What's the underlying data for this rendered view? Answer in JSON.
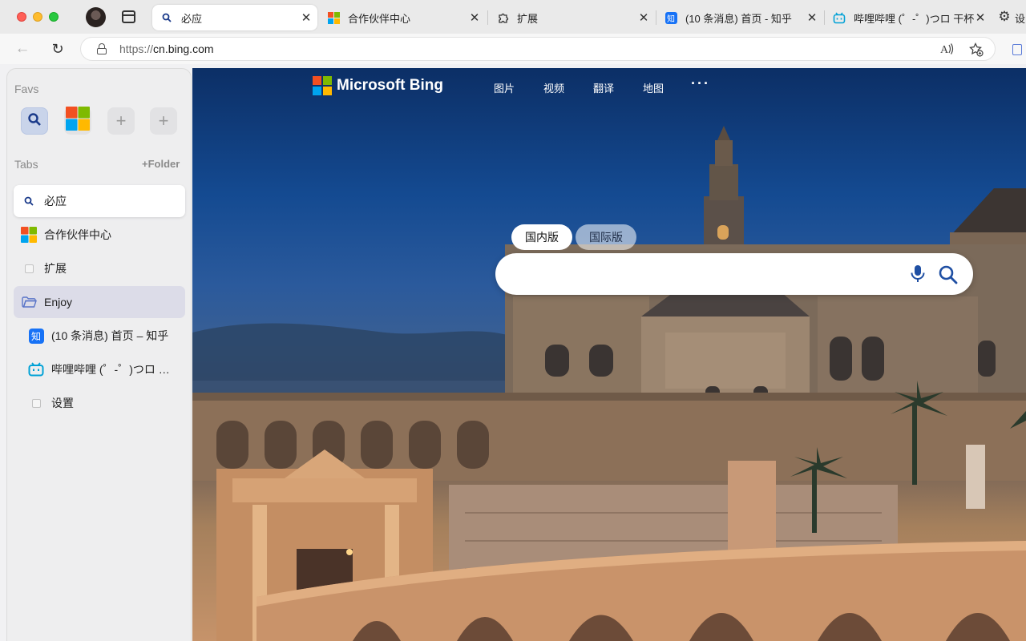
{
  "browser": {
    "tabs": [
      {
        "title": "必应",
        "favicon": "search-icon",
        "active": true
      },
      {
        "title": "合作伙伴中心",
        "favicon": "microsoft-logo-icon",
        "active": false
      },
      {
        "title": "扩展",
        "favicon": "extension-icon",
        "active": false
      },
      {
        "title": "(10 条消息) 首页 - 知乎",
        "favicon": "zhihu-icon",
        "favicon_text": "知",
        "active": false
      },
      {
        "title": "哔哩哔哩 (゜-゜)つロ 干杯~",
        "favicon": "bilibili-icon",
        "active": false
      }
    ],
    "tab_cut_text": "设",
    "close_glyph": "✕",
    "address": {
      "protocol": "https://",
      "host": "cn.bing.com"
    }
  },
  "sidebar": {
    "favs_heading": "Favs",
    "tabs_heading": "Tabs",
    "folder_button": "+Folder",
    "favs": [
      {
        "icon": "bing-search-icon"
      },
      {
        "icon": "microsoft-logo-icon"
      },
      {
        "icon": "plus-icon",
        "glyph": "+"
      },
      {
        "icon": "plus-icon",
        "glyph": "+"
      }
    ],
    "items": [
      {
        "label": "必应",
        "icon": "search-icon",
        "state": "active"
      },
      {
        "label": "合作伙伴中心",
        "icon": "microsoft-logo-icon"
      },
      {
        "label": "扩展",
        "icon": "blank-page-icon"
      },
      {
        "label": "Enjoy",
        "icon": "folder-open-icon",
        "state": "folder"
      },
      {
        "label": "(10 条消息) 首页 – 知乎",
        "icon": "zhihu-icon",
        "icon_text": "知",
        "nested": true
      },
      {
        "label": "哔哩哔哩 (゜-゜)つロ 干杯~",
        "icon": "bilibili-icon",
        "nested": true
      },
      {
        "label": "设置",
        "icon": "blank-page-icon",
        "nested": true
      }
    ]
  },
  "bing": {
    "logo_text": "Microsoft Bing",
    "nav": [
      "图片",
      "视频",
      "翻译",
      "地图"
    ],
    "more": "···",
    "region_cn": "国内版",
    "region_intl": "国际版",
    "search_placeholder": ""
  },
  "colors": {
    "ms_red": "#f25022",
    "ms_green": "#7fba00",
    "ms_blue": "#00a4ef",
    "ms_yellow": "#ffb900",
    "accent_blue": "#1772f6",
    "bilibili": "#00a1d6"
  }
}
